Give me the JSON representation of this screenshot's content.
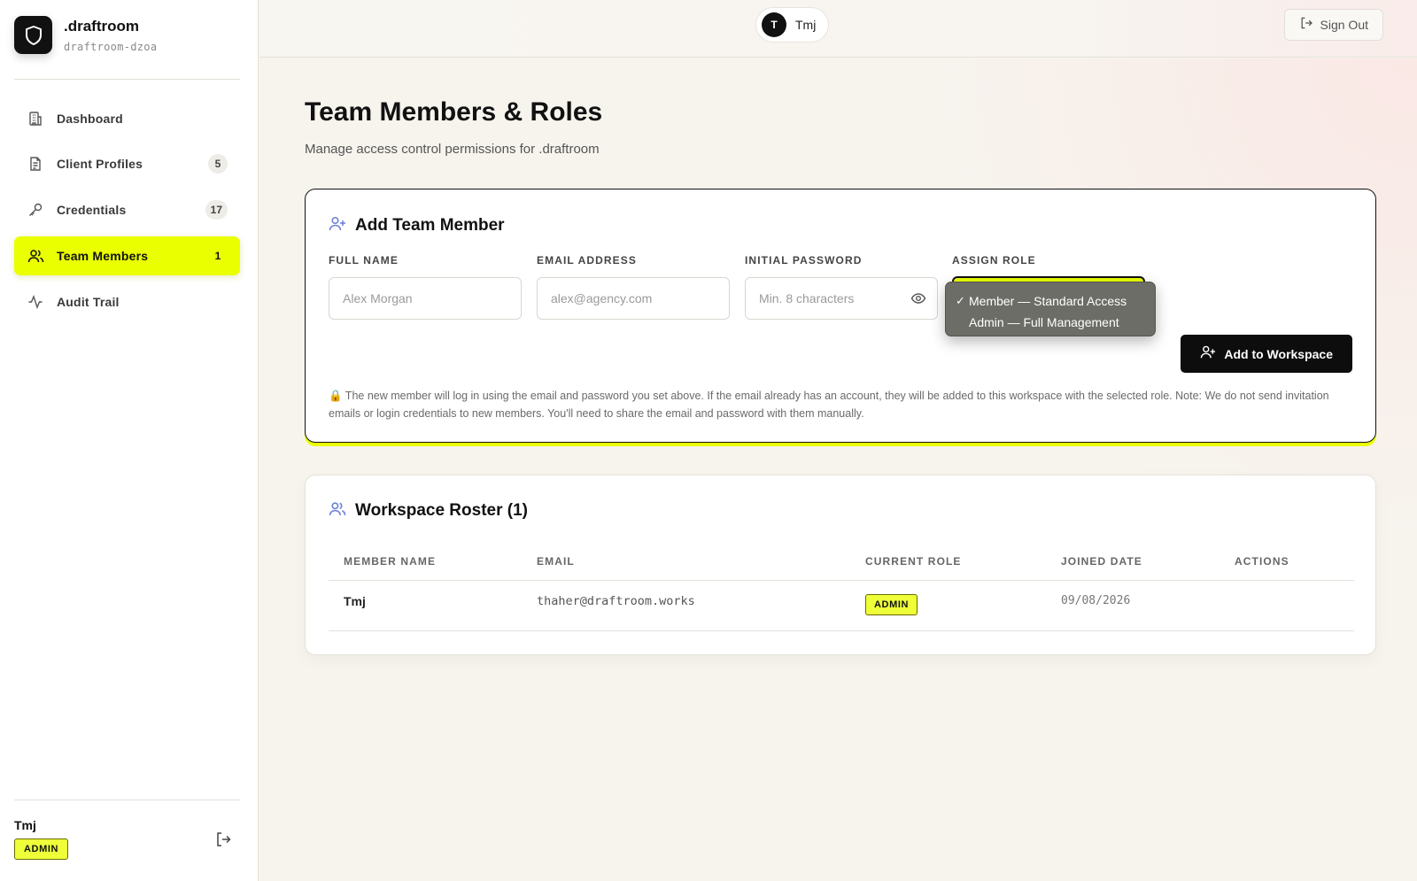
{
  "brand": {
    "name": ".draftroom",
    "slug": "draftroom-dzoa",
    "logo_icon": "shield-icon"
  },
  "sidebar": {
    "items": [
      {
        "label": "Dashboard",
        "icon": "building-icon",
        "badge": ""
      },
      {
        "label": "Client Profiles",
        "icon": "document-icon",
        "badge": "5"
      },
      {
        "label": "Credentials",
        "icon": "key-icon",
        "badge": "17"
      },
      {
        "label": "Team Members",
        "icon": "users-icon",
        "badge": "1",
        "active": true
      },
      {
        "label": "Audit Trail",
        "icon": "activity-icon",
        "badge": ""
      }
    ],
    "user": {
      "name": "Tmj",
      "role": "ADMIN"
    }
  },
  "topbar": {
    "user_initial": "T",
    "user_name": "Tmj",
    "signout_label": "Sign Out"
  },
  "page": {
    "title": "Team Members & Roles",
    "subtitle": "Manage access control permissions for .draftroom"
  },
  "add_member": {
    "title": "Add Team Member",
    "fields": {
      "full_name": {
        "label": "FULL NAME",
        "placeholder": "Alex Morgan"
      },
      "email": {
        "label": "EMAIL ADDRESS",
        "placeholder": "alex@agency.com"
      },
      "password": {
        "label": "INITIAL PASSWORD",
        "placeholder": "Min. 8 characters"
      },
      "role": {
        "label": "ASSIGN ROLE",
        "options": [
          {
            "label": "Member — Standard Access",
            "selected": true
          },
          {
            "label": "Admin — Full Management",
            "selected": false
          }
        ]
      }
    },
    "submit_label": "Add to Workspace",
    "notice": "🔒 The new member will log in using the email and password you set above. If the email already has an account, they will be added to this workspace with the selected role. Note: We do not send invitation emails or login credentials to new members. You'll need to share the email and password with them manually."
  },
  "roster": {
    "title": "Workspace Roster (1)",
    "columns": [
      "MEMBER NAME",
      "EMAIL",
      "CURRENT ROLE",
      "JOINED DATE",
      "ACTIONS"
    ],
    "rows": [
      {
        "name": "Tmj",
        "email": "thaher@draftroom.works",
        "role": "ADMIN",
        "joined": "09/08/2026",
        "actions": ""
      }
    ]
  },
  "colors": {
    "accent": "#eaff00",
    "dark": "#111111",
    "background": "#f7f4ee"
  }
}
